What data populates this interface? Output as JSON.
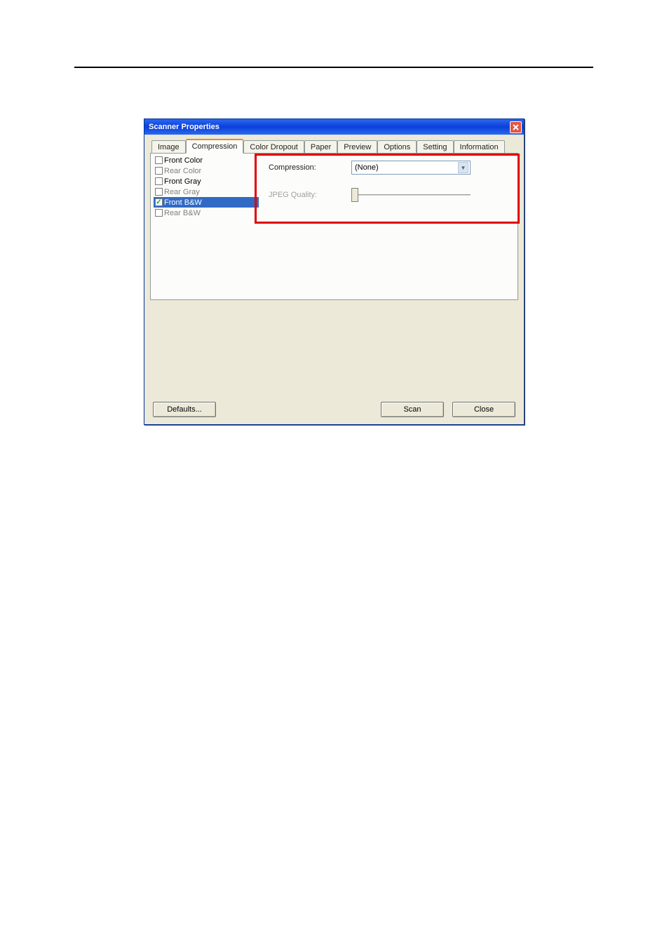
{
  "window": {
    "title": "Scanner Properties"
  },
  "tabs": [
    {
      "label": "Image"
    },
    {
      "label": "Compression"
    },
    {
      "label": "Color Dropout"
    },
    {
      "label": "Paper"
    },
    {
      "label": "Preview"
    },
    {
      "label": "Options"
    },
    {
      "label": "Setting"
    },
    {
      "label": "Information"
    }
  ],
  "activeTabIndex": 1,
  "list": {
    "items": [
      {
        "label": "Front Color",
        "checked": false,
        "enabled": true,
        "selected": false
      },
      {
        "label": "Rear Color",
        "checked": false,
        "enabled": false,
        "selected": false
      },
      {
        "label": "Front Gray",
        "checked": false,
        "enabled": true,
        "selected": false
      },
      {
        "label": "Rear Gray",
        "checked": false,
        "enabled": false,
        "selected": false
      },
      {
        "label": "Front B&W",
        "checked": true,
        "enabled": true,
        "selected": true
      },
      {
        "label": "Rear B&W",
        "checked": false,
        "enabled": false,
        "selected": false
      }
    ]
  },
  "form": {
    "compressionLabel": "Compression:",
    "compressionValue": "(None)",
    "jpegLabel": "JPEG Quality:"
  },
  "buttons": {
    "defaults": "Defaults...",
    "scan": "Scan",
    "close": "Close"
  }
}
